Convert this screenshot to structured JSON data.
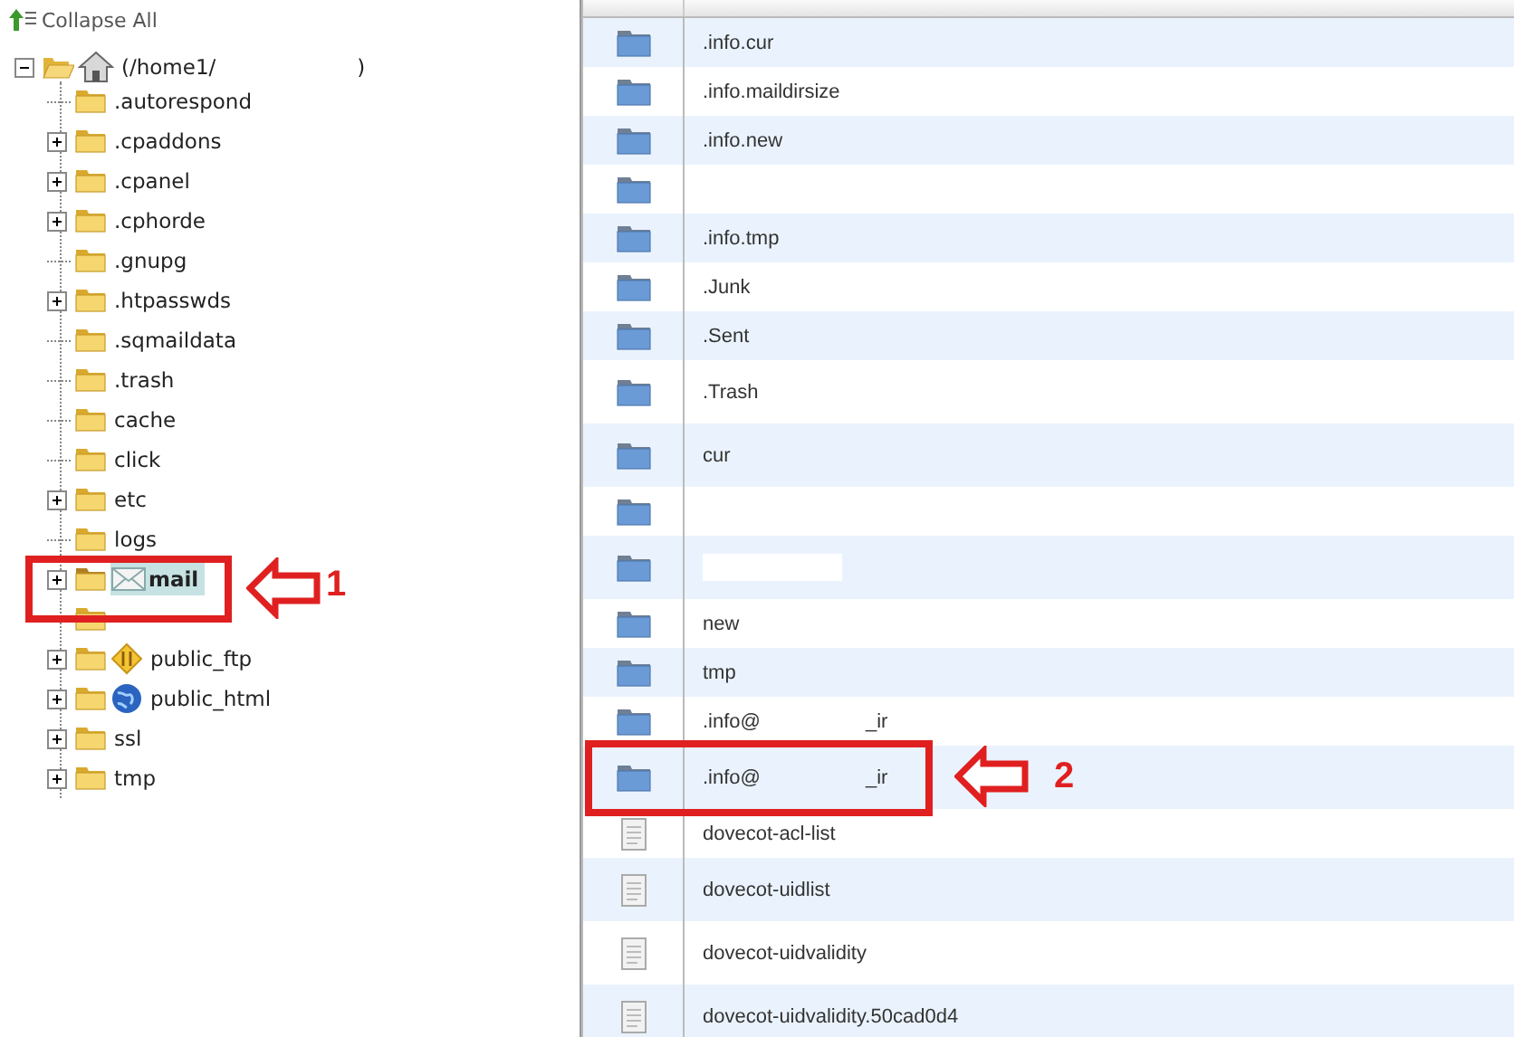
{
  "tree": {
    "collapse_label": "Collapse All",
    "root": {
      "label_start": "(/home1/",
      "label_end": ")",
      "expanded": true,
      "children": [
        {
          "name": ".autorespond",
          "expandable": false,
          "kind": "folder",
          "selected": false
        },
        {
          "name": ".cpaddons",
          "expandable": true,
          "kind": "folder",
          "selected": false
        },
        {
          "name": ".cpanel",
          "expandable": true,
          "kind": "folder",
          "selected": false
        },
        {
          "name": ".cphorde",
          "expandable": true,
          "kind": "folder",
          "selected": false
        },
        {
          "name": ".gnupg",
          "expandable": false,
          "kind": "folder",
          "selected": false
        },
        {
          "name": ".htpasswds",
          "expandable": true,
          "kind": "folder",
          "selected": false
        },
        {
          "name": ".sqmaildata",
          "expandable": false,
          "kind": "folder",
          "selected": false
        },
        {
          "name": ".trash",
          "expandable": false,
          "kind": "folder",
          "selected": false
        },
        {
          "name": "cache",
          "expandable": false,
          "kind": "folder",
          "selected": false
        },
        {
          "name": "click",
          "expandable": false,
          "kind": "folder",
          "selected": false
        },
        {
          "name": "etc",
          "expandable": true,
          "kind": "folder",
          "selected": false
        },
        {
          "name": "logs",
          "expandable": false,
          "kind": "folder",
          "selected": false
        },
        {
          "name": "mail",
          "expandable": true,
          "kind": "mail",
          "selected": true
        },
        {
          "expandable": false,
          "kind": "folder",
          "selected": false
        },
        {
          "name": "public_ftp",
          "expandable": true,
          "kind": "ftp",
          "selected": false
        },
        {
          "name": "public_html",
          "expandable": true,
          "kind": "globe",
          "selected": false
        },
        {
          "name": "ssl",
          "expandable": true,
          "kind": "folder",
          "selected": false
        },
        {
          "name": "tmp",
          "expandable": true,
          "kind": "folder",
          "selected": false
        }
      ]
    }
  },
  "table": {
    "rows": [
      {
        "kind": "folder",
        "name": ".info.cur"
      },
      {
        "kind": "folder",
        "name": ".info.maildirsize"
      },
      {
        "kind": "folder",
        "name": ".info.new"
      },
      {
        "kind": "folder"
      },
      {
        "kind": "folder",
        "name": ".info.tmp"
      },
      {
        "kind": "folder",
        "name": ".Junk"
      },
      {
        "kind": "folder",
        "name": ".Sent"
      },
      {
        "kind": "folder",
        "name": ".Trash"
      },
      {
        "kind": "folder",
        "name": "cur"
      },
      {
        "kind": "folder"
      },
      {
        "kind": "folder",
        "redacted": true
      },
      {
        "kind": "folder",
        "name": "new"
      },
      {
        "kind": "folder",
        "name": "tmp"
      },
      {
        "kind": "folder",
        "name": ".info@",
        "name_end": "_ir"
      },
      {
        "kind": "folder",
        "name": ".info@",
        "name_end": "_ir"
      },
      {
        "kind": "file",
        "name": "dovecot-acl-list"
      },
      {
        "kind": "file",
        "name": "dovecot-uidlist"
      },
      {
        "kind": "file",
        "name": "dovecot-uidvalidity"
      },
      {
        "kind": "file",
        "name": "dovecot-uidvalidity.50cad0d4"
      }
    ]
  },
  "callouts": [
    {
      "number": "1"
    },
    {
      "number": "2"
    }
  ]
}
